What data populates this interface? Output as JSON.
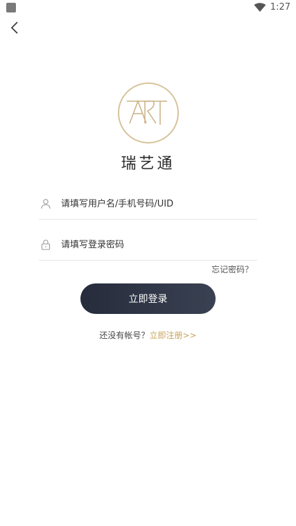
{
  "status": {
    "time": "1:27"
  },
  "brand": {
    "name": "瑞艺通",
    "logo_mark": "ART",
    "accent": "#c9a45a"
  },
  "login": {
    "username_placeholder": "请填写用户名/手机号码/UID",
    "password_placeholder": "请填写登录密码",
    "forgot": "忘记密码？",
    "submit": "立即登录",
    "no_account": "还没有帐号？",
    "register": "立即注册>>"
  },
  "icons": {
    "back": "back-arrow-icon",
    "user": "user-icon",
    "lock": "lock-icon",
    "wifi": "wifi-icon"
  }
}
